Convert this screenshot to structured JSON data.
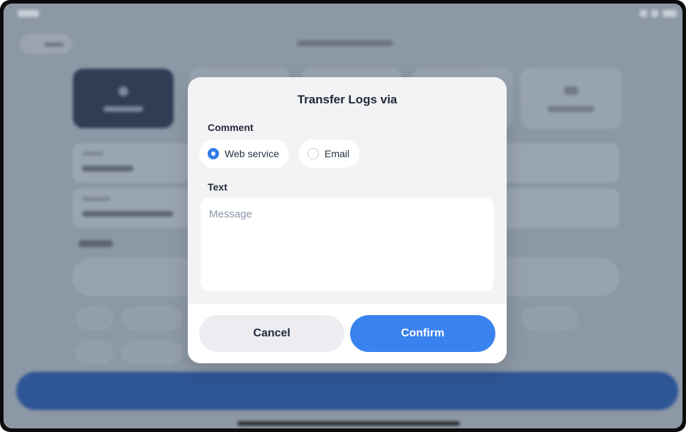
{
  "modal": {
    "title": "Transfer Logs via",
    "comment_label": "Comment",
    "options": [
      {
        "label": "Web service",
        "selected": true
      },
      {
        "label": "Email",
        "selected": false
      }
    ],
    "text_label": "Text",
    "message_placeholder": "Message",
    "message_value": "",
    "cancel_label": "Cancel",
    "confirm_label": "Confirm"
  },
  "colors": {
    "accent": "#3a82ee",
    "modal_bg": "#f3f3f6",
    "backdrop": "#8d98a6"
  }
}
